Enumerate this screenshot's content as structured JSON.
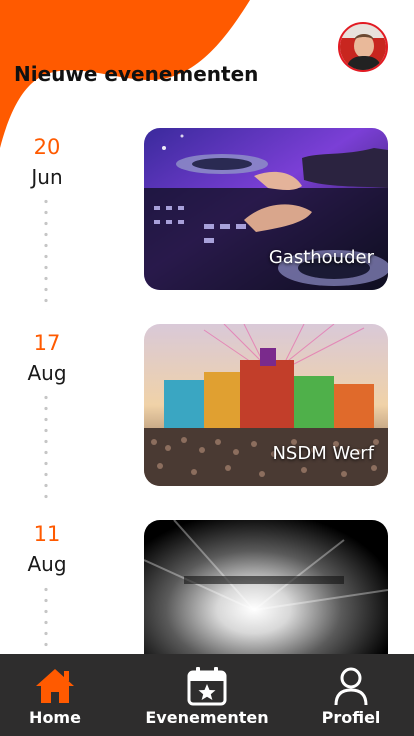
{
  "header": {
    "title": "Nieuwe evenementen"
  },
  "profile": {
    "avatar_icon": "user-avatar"
  },
  "theme": {
    "accent": "#ff5a00",
    "navbar_bg": "#2e2d2d"
  },
  "events": [
    {
      "day": "20",
      "month": "Jun",
      "name": "Gasthouder"
    },
    {
      "day": "17",
      "month": "Aug",
      "name": "NSDM Werf"
    },
    {
      "day": "11",
      "month": "Aug",
      "name": ""
    }
  ],
  "nav": {
    "home": "Home",
    "events": "Evenementen",
    "profile": "Profiel"
  }
}
